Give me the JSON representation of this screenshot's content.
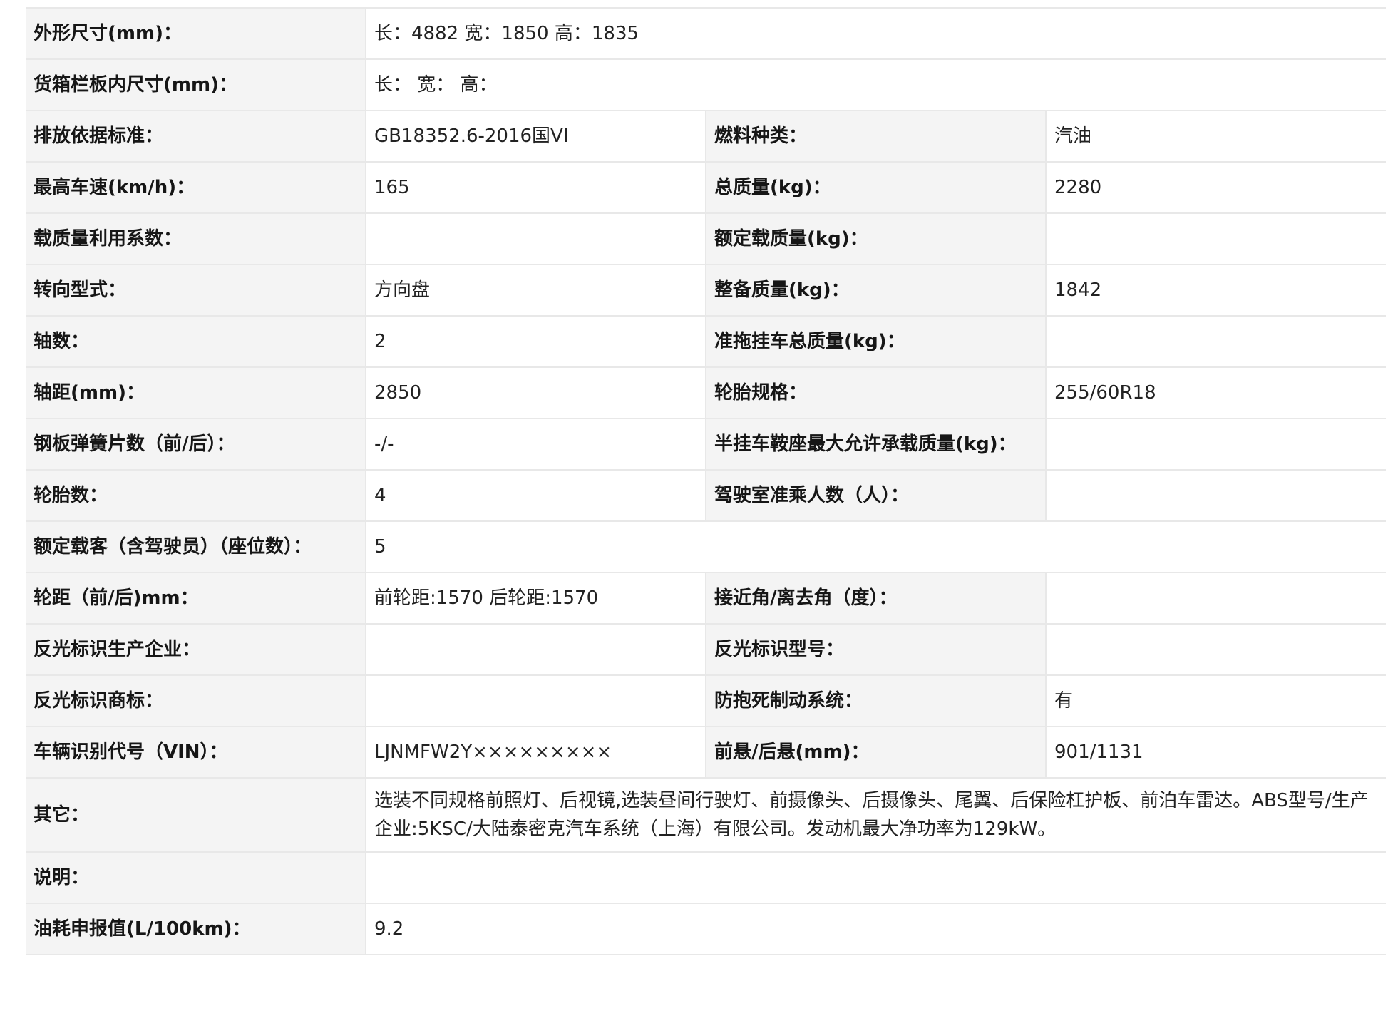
{
  "rows": [
    {
      "label": "外形尺寸(mm)：",
      "value": "长：4882 宽：1850 高：1835"
    },
    {
      "label": "货箱栏板内尺寸(mm)：",
      "value": "长：  宽：  高："
    },
    {
      "label": "排放依据标准：",
      "value": "GB18352.6-2016国VI",
      "label2": "燃料种类：",
      "value2": "汽油"
    },
    {
      "label": "最高车速(km/h)：",
      "value": "165",
      "label2": "总质量(kg)：",
      "value2": "2280"
    },
    {
      "label": "载质量利用系数：",
      "value": "",
      "label2": "额定载质量(kg)：",
      "value2": ""
    },
    {
      "label": "转向型式：",
      "value": "方向盘",
      "label2": "整备质量(kg)：",
      "value2": "1842"
    },
    {
      "label": "轴数：",
      "value": "2",
      "label2": "准拖挂车总质量(kg)：",
      "value2": ""
    },
    {
      "label": "轴距(mm)：",
      "value": "2850",
      "label2": "轮胎规格：",
      "value2": "255/60R18"
    },
    {
      "label": "钢板弹簧片数（前/后）：",
      "value": "-/-",
      "label2": "半挂车鞍座最大允许承载质量(kg)：",
      "value2": ""
    },
    {
      "label": "轮胎数：",
      "value": "4",
      "label2": "驾驶室准乘人数（人）：",
      "value2": ""
    },
    {
      "label": "额定载客（含驾驶员）（座位数）：",
      "value": "5"
    },
    {
      "label": "轮距（前/后)mm：",
      "value": "前轮距:1570 后轮距:1570",
      "label2": "接近角/离去角（度）：",
      "value2": ""
    },
    {
      "label": "反光标识生产企业：",
      "value": "",
      "label2": "反光标识型号：",
      "value2": ""
    },
    {
      "label": "反光标识商标：",
      "value": "",
      "label2": "防抱死制动系统：",
      "value2": "有"
    },
    {
      "label": "车辆识别代号（VIN）：",
      "value": "LJNMFW2Y×××××××××",
      "label2": "前悬/后悬(mm)：",
      "value2": "901/1131"
    },
    {
      "label": "其它：",
      "value": "选装不同规格前照灯、后视镜,选装昼间行驶灯、前摄像头、后摄像头、尾翼、后保险杠护板、前泊车雷达。ABS型号/生产企业:5KSC/大陆泰密克汽车系统（上海）有限公司。发动机最大净功率为129kW。"
    },
    {
      "label": "说明：",
      "value": ""
    },
    {
      "label": "油耗申报值(L/100km)：",
      "value": "9.2"
    }
  ]
}
